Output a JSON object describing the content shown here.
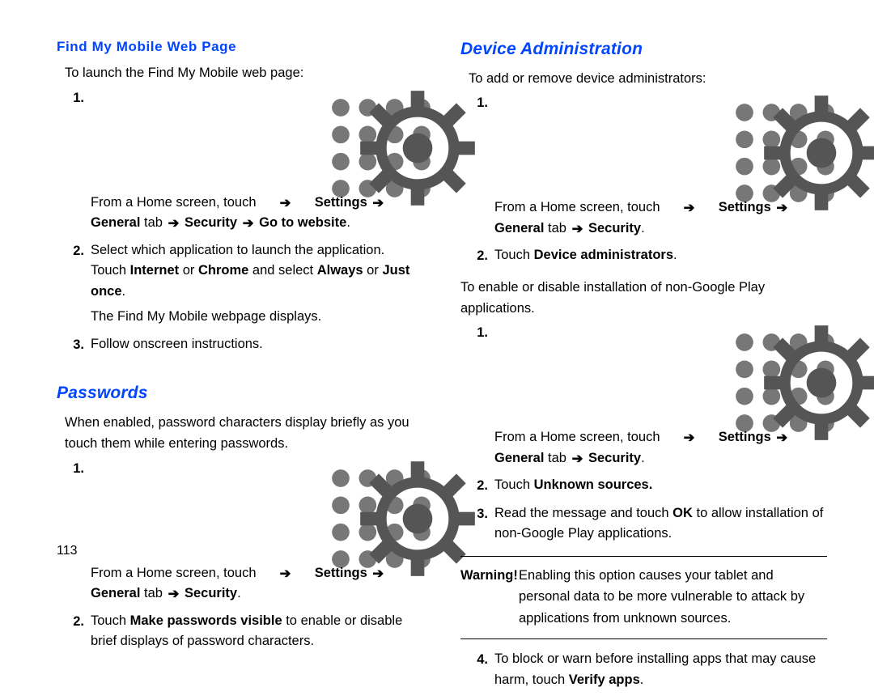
{
  "page_number": "113",
  "arrow": "➔",
  "left": {
    "h1": "Find My Mobile Web Page",
    "intro": "To launch the Find My Mobile web page:",
    "st1_a": "From a Home screen, touch ",
    "st1_b": "Settings",
    "st1_c": "General",
    "st1_d": " tab ",
    "st1_e": "Security",
    "st1_f": "Go to website",
    "st2_a": "Select which application to launch the application. Touch ",
    "st2_b": "Internet",
    "st2_c": " or ",
    "st2_d": "Chrome",
    "st2_e": " and select ",
    "st2_f": "Always",
    "st2_g": " or ",
    "st2_h": "Just once",
    "st2_sub": "The Find My Mobile webpage displays.",
    "st3": "Follow onscreen instructions.",
    "h2": "Passwords",
    "pw_intro": "When enabled, password characters display briefly as you touch them while entering passwords.",
    "pw1_a": "From a Home screen, touch ",
    "pw1_b": "Settings",
    "pw1_c": "General",
    "pw1_d": " tab ",
    "pw1_e": "Security",
    "pw2_a": "Touch ",
    "pw2_b": "Make passwords visible",
    "pw2_c": " to enable or disable brief displays of password characters."
  },
  "right": {
    "h1": "Device Administration",
    "intro": "To add or remove device administrators:",
    "s1_a": "From a Home screen, touch ",
    "s1_b": "Settings",
    "s1_c": "General",
    "s1_d": " tab ",
    "s1_e": "Security",
    "s2_a": "Touch ",
    "s2_b": "Device administrators",
    "mid": "To enable or disable installation of non-Google Play applications.",
    "u1_a": "From a Home screen, touch ",
    "u1_b": "Settings",
    "u1_c": "General",
    "u1_d": " tab ",
    "u1_e": "Security",
    "u2_a": "Touch ",
    "u2_b": "Unknown sources.",
    "u3_a": "Read the message and touch ",
    "u3_b": "OK",
    "u3_c": " to allow installation of non-Google Play applications.",
    "warn_label": "Warning! ",
    "warn_txt": "Enabling this option causes your tablet and personal data to be more vulnerable to attack by applications from unknown sources.",
    "u4_a": "To block or warn before installing apps that may cause harm, touch ",
    "u4_b": "Verify apps"
  }
}
